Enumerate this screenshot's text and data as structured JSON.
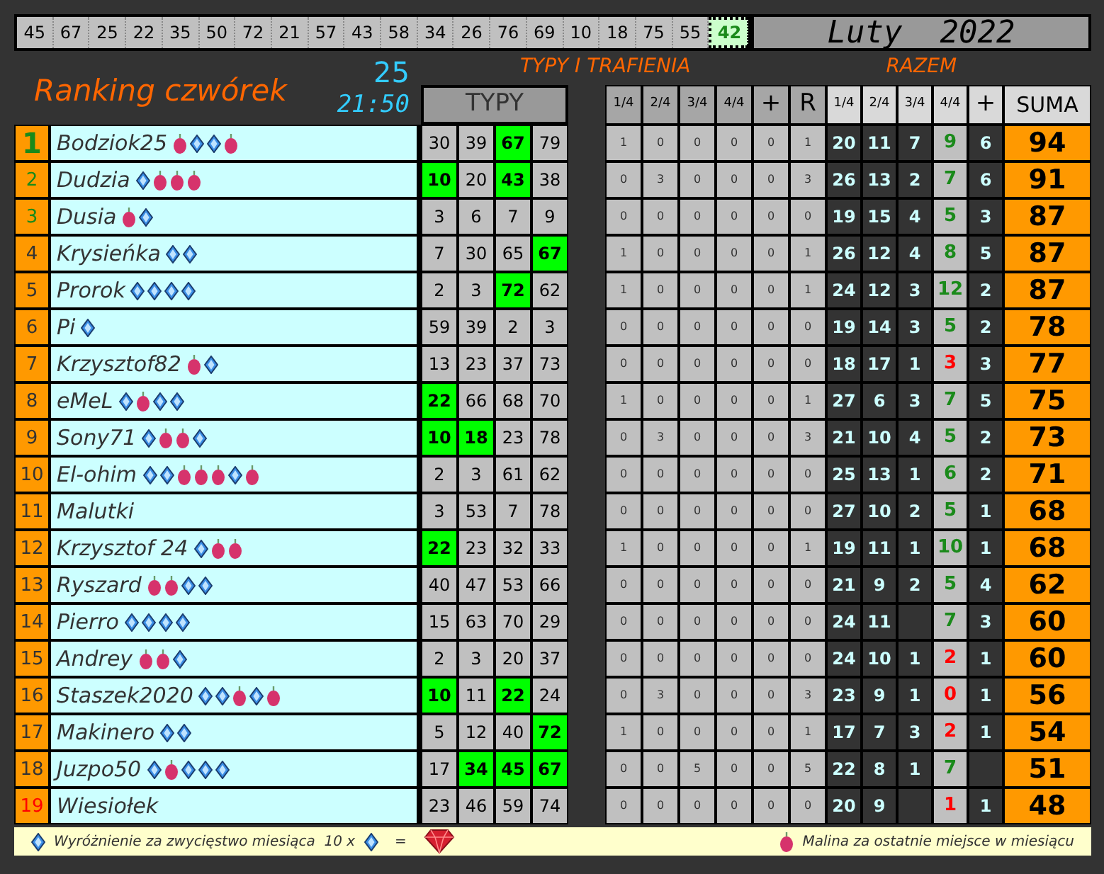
{
  "numbers": [
    {
      "value": "45",
      "selected": false
    },
    {
      "value": "67",
      "selected": false
    },
    {
      "value": "25",
      "selected": false
    },
    {
      "value": "22",
      "selected": false
    },
    {
      "value": "35",
      "selected": false
    },
    {
      "value": "50",
      "selected": false
    },
    {
      "value": "72",
      "selected": false
    },
    {
      "value": "21",
      "selected": false
    },
    {
      "value": "57",
      "selected": false
    },
    {
      "value": "43",
      "selected": false
    },
    {
      "value": "58",
      "selected": false
    },
    {
      "value": "34",
      "selected": false
    },
    {
      "value": "26",
      "selected": false
    },
    {
      "value": "76",
      "selected": false
    },
    {
      "value": "69",
      "selected": false
    },
    {
      "value": "10",
      "selected": false
    },
    {
      "value": "18",
      "selected": false
    },
    {
      "value": "75",
      "selected": false
    },
    {
      "value": "55",
      "selected": false
    },
    {
      "value": "42",
      "selected": true
    }
  ],
  "month_title": "Luty  2022",
  "title": "Ranking czwórek",
  "draw_count": "25",
  "time": "21:50",
  "section_tips_hits": "TYPY I TRAFIENIA",
  "section_total": "RAZEM",
  "tips_header": "TYPY",
  "hits_columns": [
    "1/4",
    "2/4",
    "3/4",
    "4/4",
    "+",
    "R"
  ],
  "total_columns": [
    "1/4",
    "2/4",
    "3/4",
    "4/4",
    "+",
    "SUMA"
  ],
  "rows": [
    {
      "rank": "1",
      "color": "#1a8a1a",
      "name": "Bodziok25",
      "badges": [
        {
          "kind": "raspberry"
        },
        {
          "kind": "diamond"
        },
        {
          "kind": "diamond"
        },
        {
          "kind": "raspberry"
        }
      ],
      "tips": [
        {
          "value": "30",
          "hit": false
        },
        {
          "value": "39",
          "hit": false
        },
        {
          "value": "67",
          "hit": true
        },
        {
          "value": "79",
          "hit": false
        }
      ],
      "hits": [
        "1",
        "0",
        "0",
        "0",
        "0",
        "1"
      ],
      "quarter_1": "20",
      "quarter_2": "11",
      "quarter_3": "7",
      "full": {
        "value": "9",
        "color": "#1a8a1a"
      },
      "plus": "6",
      "sum": "94"
    },
    {
      "rank": "2",
      "color": "#1a8a1a",
      "name": "Dudzia",
      "badges": [
        {
          "kind": "diamond"
        },
        {
          "kind": "raspberry"
        },
        {
          "kind": "raspberry"
        },
        {
          "kind": "raspberry"
        }
      ],
      "tips": [
        {
          "value": "10",
          "hit": true
        },
        {
          "value": "20",
          "hit": false
        },
        {
          "value": "43",
          "hit": true
        },
        {
          "value": "38",
          "hit": false
        }
      ],
      "hits": [
        "0",
        "3",
        "0",
        "0",
        "0",
        "3"
      ],
      "quarter_1": "26",
      "quarter_2": "13",
      "quarter_3": "2",
      "full": {
        "value": "7",
        "color": "#1a8a1a"
      },
      "plus": "6",
      "sum": "91"
    },
    {
      "rank": "3",
      "color": "#1a8a1a",
      "name": "Dusia",
      "badges": [
        {
          "kind": "raspberry"
        },
        {
          "kind": "diamond"
        }
      ],
      "tips": [
        {
          "value": "3",
          "hit": false
        },
        {
          "value": "6",
          "hit": false
        },
        {
          "value": "7",
          "hit": false
        },
        {
          "value": "9",
          "hit": false
        }
      ],
      "hits": [
        "0",
        "0",
        "0",
        "0",
        "0",
        "0"
      ],
      "quarter_1": "19",
      "quarter_2": "15",
      "quarter_3": "4",
      "full": {
        "value": "5",
        "color": "#1a8a1a"
      },
      "plus": "3",
      "sum": "87"
    },
    {
      "rank": "4",
      "color": "#333333",
      "name": "Krysieńka",
      "badges": [
        {
          "kind": "diamond"
        },
        {
          "kind": "diamond"
        }
      ],
      "tips": [
        {
          "value": "7",
          "hit": false
        },
        {
          "value": "30",
          "hit": false
        },
        {
          "value": "65",
          "hit": false
        },
        {
          "value": "67",
          "hit": true
        }
      ],
      "hits": [
        "1",
        "0",
        "0",
        "0",
        "0",
        "1"
      ],
      "quarter_1": "26",
      "quarter_2": "12",
      "quarter_3": "4",
      "full": {
        "value": "8",
        "color": "#1a8a1a"
      },
      "plus": "5",
      "sum": "87"
    },
    {
      "rank": "5",
      "color": "#333333",
      "name": "Prorok",
      "badges": [
        {
          "kind": "diamond"
        },
        {
          "kind": "diamond"
        },
        {
          "kind": "diamond"
        },
        {
          "kind": "diamond"
        }
      ],
      "tips": [
        {
          "value": "2",
          "hit": false
        },
        {
          "value": "3",
          "hit": false
        },
        {
          "value": "72",
          "hit": true
        },
        {
          "value": "62",
          "hit": false
        }
      ],
      "hits": [
        "1",
        "0",
        "0",
        "0",
        "0",
        "1"
      ],
      "quarter_1": "24",
      "quarter_2": "12",
      "quarter_3": "3",
      "full": {
        "value": "12",
        "color": "#1a8a1a"
      },
      "plus": "2",
      "sum": "87"
    },
    {
      "rank": "6",
      "color": "#333333",
      "name": "Pi",
      "badges": [
        {
          "kind": "diamond"
        }
      ],
      "tips": [
        {
          "value": "59",
          "hit": false
        },
        {
          "value": "39",
          "hit": false
        },
        {
          "value": "2",
          "hit": false
        },
        {
          "value": "3",
          "hit": false
        }
      ],
      "hits": [
        "0",
        "0",
        "0",
        "0",
        "0",
        "0"
      ],
      "quarter_1": "19",
      "quarter_2": "14",
      "quarter_3": "3",
      "full": {
        "value": "5",
        "color": "#1a8a1a"
      },
      "plus": "2",
      "sum": "78"
    },
    {
      "rank": "7",
      "color": "#333333",
      "name": "Krzysztof82",
      "badges": [
        {
          "kind": "raspberry"
        },
        {
          "kind": "diamond"
        }
      ],
      "tips": [
        {
          "value": "13",
          "hit": false
        },
        {
          "value": "23",
          "hit": false
        },
        {
          "value": "37",
          "hit": false
        },
        {
          "value": "73",
          "hit": false
        }
      ],
      "hits": [
        "0",
        "0",
        "0",
        "0",
        "0",
        "0"
      ],
      "quarter_1": "18",
      "quarter_2": "17",
      "quarter_3": "1",
      "full": {
        "value": "3",
        "color": "#ff0000"
      },
      "plus": "3",
      "sum": "77"
    },
    {
      "rank": "8",
      "color": "#333333",
      "name": "eMeL",
      "badges": [
        {
          "kind": "diamond"
        },
        {
          "kind": "raspberry"
        },
        {
          "kind": "diamond"
        },
        {
          "kind": "diamond"
        }
      ],
      "tips": [
        {
          "value": "22",
          "hit": true
        },
        {
          "value": "66",
          "hit": false
        },
        {
          "value": "68",
          "hit": false
        },
        {
          "value": "70",
          "hit": false
        }
      ],
      "hits": [
        "1",
        "0",
        "0",
        "0",
        "0",
        "1"
      ],
      "quarter_1": "27",
      "quarter_2": "6",
      "quarter_3": "3",
      "full": {
        "value": "7",
        "color": "#1a8a1a"
      },
      "plus": "5",
      "sum": "75"
    },
    {
      "rank": "9",
      "color": "#333333",
      "name": "Sony71",
      "badges": [
        {
          "kind": "diamond"
        },
        {
          "kind": "raspberry"
        },
        {
          "kind": "raspberry"
        },
        {
          "kind": "diamond"
        }
      ],
      "tips": [
        {
          "value": "10",
          "hit": true
        },
        {
          "value": "18",
          "hit": true
        },
        {
          "value": "23",
          "hit": false
        },
        {
          "value": "78",
          "hit": false
        }
      ],
      "hits": [
        "0",
        "3",
        "0",
        "0",
        "0",
        "3"
      ],
      "quarter_1": "21",
      "quarter_2": "10",
      "quarter_3": "4",
      "full": {
        "value": "5",
        "color": "#1a8a1a"
      },
      "plus": "2",
      "sum": "73"
    },
    {
      "rank": "10",
      "color": "#333333",
      "name": "El-ohim",
      "badges": [
        {
          "kind": "diamond"
        },
        {
          "kind": "diamond"
        },
        {
          "kind": "raspberry"
        },
        {
          "kind": "raspberry"
        },
        {
          "kind": "raspberry"
        },
        {
          "kind": "diamond"
        },
        {
          "kind": "raspberry"
        }
      ],
      "tips": [
        {
          "value": "2",
          "hit": false
        },
        {
          "value": "3",
          "hit": false
        },
        {
          "value": "61",
          "hit": false
        },
        {
          "value": "62",
          "hit": false
        }
      ],
      "hits": [
        "0",
        "0",
        "0",
        "0",
        "0",
        "0"
      ],
      "quarter_1": "25",
      "quarter_2": "13",
      "quarter_3": "1",
      "full": {
        "value": "6",
        "color": "#1a8a1a"
      },
      "plus": "2",
      "sum": "71"
    },
    {
      "rank": "11",
      "color": "#333333",
      "name": "Malutki",
      "tips": [
        {
          "value": "3",
          "hit": false
        },
        {
          "value": "53",
          "hit": false
        },
        {
          "value": "7",
          "hit": false
        },
        {
          "value": "78",
          "hit": false
        }
      ],
      "hits": [
        "0",
        "0",
        "0",
        "0",
        "0",
        "0"
      ],
      "quarter_1": "27",
      "quarter_2": "10",
      "quarter_3": "2",
      "full": {
        "value": "5",
        "color": "#1a8a1a"
      },
      "plus": "1",
      "sum": "68"
    },
    {
      "rank": "12",
      "color": "#333333",
      "name": "Krzysztof 24",
      "badges": [
        {
          "kind": "diamond"
        },
        {
          "kind": "raspberry"
        },
        {
          "kind": "raspberry"
        }
      ],
      "tips": [
        {
          "value": "22",
          "hit": true
        },
        {
          "value": "23",
          "hit": false
        },
        {
          "value": "32",
          "hit": false
        },
        {
          "value": "33",
          "hit": false
        }
      ],
      "hits": [
        "1",
        "0",
        "0",
        "0",
        "0",
        "1"
      ],
      "quarter_1": "19",
      "quarter_2": "11",
      "quarter_3": "1",
      "full": {
        "value": "10",
        "color": "#1a8a1a"
      },
      "plus": "1",
      "sum": "68"
    },
    {
      "rank": "13",
      "color": "#333333",
      "name": "Ryszard",
      "badges": [
        {
          "kind": "raspberry"
        },
        {
          "kind": "raspberry"
        },
        {
          "kind": "diamond"
        },
        {
          "kind": "diamond"
        }
      ],
      "tips": [
        {
          "value": "40",
          "hit": false
        },
        {
          "value": "47",
          "hit": false
        },
        {
          "value": "53",
          "hit": false
        },
        {
          "value": "66",
          "hit": false
        }
      ],
      "hits": [
        "0",
        "0",
        "0",
        "0",
        "0",
        "0"
      ],
      "quarter_1": "21",
      "quarter_2": "9",
      "quarter_3": "2",
      "full": {
        "value": "5",
        "color": "#1a8a1a"
      },
      "plus": "4",
      "sum": "62"
    },
    {
      "rank": "14",
      "color": "#333333",
      "name": "Pierro",
      "badges": [
        {
          "kind": "diamond"
        },
        {
          "kind": "diamond"
        },
        {
          "kind": "diamond"
        },
        {
          "kind": "diamond"
        }
      ],
      "tips": [
        {
          "value": "15",
          "hit": false
        },
        {
          "value": "63",
          "hit": false
        },
        {
          "value": "70",
          "hit": false
        },
        {
          "value": "29",
          "hit": false
        }
      ],
      "hits": [
        "0",
        "0",
        "0",
        "0",
        "0",
        "0"
      ],
      "quarter_1": "24",
      "quarter_2": "11",
      "full": {
        "value": "7",
        "color": "#1a8a1a"
      },
      "plus": "3",
      "sum": "60"
    },
    {
      "rank": "15",
      "color": "#333333",
      "name": "Andrey",
      "badges": [
        {
          "kind": "raspberry"
        },
        {
          "kind": "raspberry"
        },
        {
          "kind": "diamond"
        }
      ],
      "tips": [
        {
          "value": "2",
          "hit": false
        },
        {
          "value": "3",
          "hit": false
        },
        {
          "value": "20",
          "hit": false
        },
        {
          "value": "37",
          "hit": false
        }
      ],
      "hits": [
        "0",
        "0",
        "0",
        "0",
        "0",
        "0"
      ],
      "quarter_1": "24",
      "quarter_2": "10",
      "quarter_3": "1",
      "full": {
        "value": "2",
        "color": "#ff0000"
      },
      "plus": "1",
      "sum": "60"
    },
    {
      "rank": "16",
      "color": "#333333",
      "name": "Staszek2020",
      "badges": [
        {
          "kind": "diamond"
        },
        {
          "kind": "diamond"
        },
        {
          "kind": "raspberry"
        },
        {
          "kind": "diamond"
        },
        {
          "kind": "raspberry"
        }
      ],
      "tips": [
        {
          "value": "10",
          "hit": true
        },
        {
          "value": "11",
          "hit": false
        },
        {
          "value": "22",
          "hit": true
        },
        {
          "value": "24",
          "hit": false
        }
      ],
      "hits": [
        "0",
        "3",
        "0",
        "0",
        "0",
        "3"
      ],
      "quarter_1": "23",
      "quarter_2": "9",
      "quarter_3": "1",
      "full": {
        "value": "0",
        "color": "#ff0000"
      },
      "plus": "1",
      "sum": "56"
    },
    {
      "rank": "17",
      "color": "#333333",
      "name": "Makinero",
      "badges": [
        {
          "kind": "diamond"
        },
        {
          "kind": "diamond"
        }
      ],
      "tips": [
        {
          "value": "5",
          "hit": false
        },
        {
          "value": "12",
          "hit": false
        },
        {
          "value": "40",
          "hit": false
        },
        {
          "value": "72",
          "hit": true
        }
      ],
      "hits": [
        "1",
        "0",
        "0",
        "0",
        "0",
        "1"
      ],
      "quarter_1": "17",
      "quarter_2": "7",
      "quarter_3": "3",
      "full": {
        "value": "2",
        "color": "#ff0000"
      },
      "plus": "1",
      "sum": "54"
    },
    {
      "rank": "18",
      "color": "#333333",
      "name": "Juzpo50",
      "badges": [
        {
          "kind": "diamond"
        },
        {
          "kind": "raspberry"
        },
        {
          "kind": "diamond"
        },
        {
          "kind": "diamond"
        },
        {
          "kind": "diamond"
        }
      ],
      "tips": [
        {
          "value": "17",
          "hit": false
        },
        {
          "value": "34",
          "hit": true
        },
        {
          "value": "45",
          "hit": true
        },
        {
          "value": "67",
          "hit": true
        }
      ],
      "hits": [
        "0",
        "0",
        "5",
        "0",
        "0",
        "5"
      ],
      "quarter_1": "22",
      "quarter_2": "8",
      "quarter_3": "1",
      "full": {
        "value": "7",
        "color": "#1a8a1a"
      },
      "sum": "51"
    },
    {
      "rank": "19",
      "color": "#ff0000",
      "name": "Wiesiołek",
      "tips": [
        {
          "value": "23",
          "hit": false
        },
        {
          "value": "46",
          "hit": false
        },
        {
          "value": "59",
          "hit": false
        },
        {
          "value": "74",
          "hit": false
        }
      ],
      "hits": [
        "0",
        "0",
        "0",
        "0",
        "0",
        "0"
      ],
      "quarter_1": "20",
      "quarter_2": "9",
      "full": {
        "value": "1",
        "color": "#ff0000"
      },
      "plus": "1",
      "sum": "48"
    }
  ],
  "legend": {
    "diamond_text": "Wyróżnienie za zwycięstwo miesiąca  10 x",
    "equals": "=",
    "raspberry_text": "Malina za ostatnie miejsce w miesiącu"
  }
}
